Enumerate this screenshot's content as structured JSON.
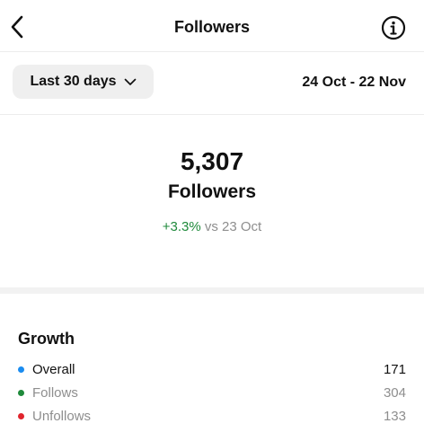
{
  "header": {
    "title": "Followers",
    "back_icon": "chevron-left-icon",
    "info_icon": "info-icon"
  },
  "filter": {
    "range_label": "Last 30 days",
    "range_icon": "chevron-down-icon",
    "date_range": "24 Oct - 22 Nov"
  },
  "summary": {
    "count": "5,307",
    "label": "Followers",
    "change_percent": "+3.3%",
    "compare_text": "vs 23 Oct"
  },
  "growth": {
    "title": "Growth",
    "rows": [
      {
        "label": "Overall",
        "value": "171",
        "dot_color": "#1a8cf0"
      },
      {
        "label": "Follows",
        "value": "304",
        "dot_color": "#1f8a3b"
      },
      {
        "label": "Unfollows",
        "value": "133",
        "dot_color": "#e0242d"
      }
    ]
  },
  "colors": {
    "positive": "#1f8a3b",
    "muted": "#8e8e8e",
    "button_bg": "#efefef"
  }
}
